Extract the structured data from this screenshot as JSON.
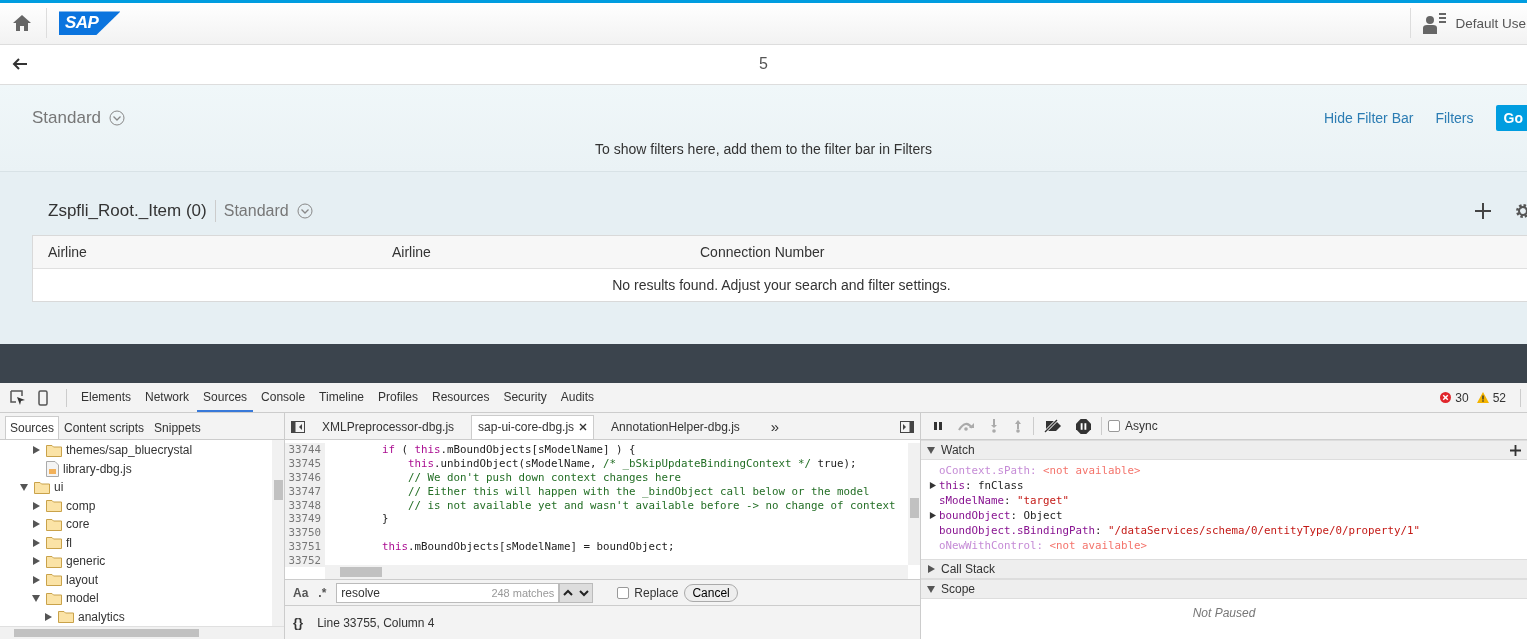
{
  "shell": {
    "logo": "SAP",
    "user": "Default Use"
  },
  "page": {
    "title": "5"
  },
  "filter_bar": {
    "variant": "Standard",
    "links": [
      "Hide Filter Bar",
      "Filters"
    ],
    "go_button": "Go",
    "message": "To show filters here, add them to the filter bar in Filters"
  },
  "table": {
    "title": "Zspfli_Root._Item (0)",
    "variant": "Standard",
    "columns": [
      "Airline",
      "Airline",
      "Connection Number"
    ],
    "no_data": "No results found. Adjust your search and filter settings."
  },
  "devtools": {
    "tabs": [
      {
        "label": "Elements",
        "selected": false
      },
      {
        "label": "Network",
        "selected": false
      },
      {
        "label": "Sources",
        "selected": true
      },
      {
        "label": "Console",
        "selected": false
      },
      {
        "label": "Timeline",
        "selected": false
      },
      {
        "label": "Profiles",
        "selected": false
      },
      {
        "label": "Resources",
        "selected": false
      },
      {
        "label": "Security",
        "selected": false
      },
      {
        "label": "Audits",
        "selected": false
      }
    ],
    "errors": "30",
    "warnings": "52",
    "navigator": {
      "tabs": [
        {
          "label": "Sources",
          "selected": true
        },
        {
          "label": "Content scripts",
          "selected": false
        },
        {
          "label": "Snippets",
          "selected": false
        }
      ],
      "tree": [
        {
          "children": [
            {
              "name": "themes/sap_bluecrystal",
              "kind": "folder",
              "expanded": false
            },
            {
              "name": "library-dbg.js",
              "kind": "file"
            }
          ]
        },
        {
          "name": "ui",
          "kind": "folder",
          "expanded": true,
          "children": [
            {
              "name": "comp",
              "kind": "folder",
              "expanded": false
            },
            {
              "name": "core",
              "kind": "folder",
              "expanded": false
            },
            {
              "name": "fl",
              "kind": "folder",
              "expanded": false
            },
            {
              "name": "generic",
              "kind": "folder",
              "expanded": false
            },
            {
              "name": "layout",
              "kind": "folder",
              "expanded": false
            },
            {
              "name": "model",
              "kind": "folder",
              "expanded": true,
              "children": [
                {
                  "name": "analytics",
                  "kind": "folder",
                  "expanded": false
                }
              ]
            }
          ]
        }
      ]
    },
    "editor": {
      "tabs": [
        {
          "label": "XMLPreprocessor-dbg.js",
          "selected": false
        },
        {
          "label": "sap-ui-core-dbg.js",
          "selected": true
        },
        {
          "label": "AnnotationHelper-dbg.js",
          "selected": false
        }
      ],
      "more": "»",
      "lines": [
        {
          "number": "33744",
          "tokens": [
            {
              "kind": "keyword",
              "text": "        if"
            },
            {
              "kind": "plain",
              "text": " ( "
            },
            {
              "kind": "keyword",
              "text": "this"
            },
            {
              "kind": "plain",
              "text": ".mBoundObjects[sModelName] ) {"
            }
          ]
        },
        {
          "number": "33745",
          "tokens": [
            {
              "kind": "keyword",
              "text": "            this"
            },
            {
              "kind": "plain",
              "text": ".unbindObject(sModelName, "
            },
            {
              "kind": "comment",
              "text": "/* _bSkipUpdateBindingContext */"
            },
            {
              "kind": "plain",
              "text": " true);"
            }
          ]
        },
        {
          "number": "33746",
          "tokens": [
            {
              "kind": "comment",
              "text": "            // We don't push down context changes here"
            }
          ]
        },
        {
          "number": "33747",
          "tokens": [
            {
              "kind": "comment",
              "text": "            // Either this will happen with the _bindObject call below or the model"
            }
          ]
        },
        {
          "number": "33748",
          "tokens": [
            {
              "kind": "comment",
              "text": "            // is not available yet and wasn't available before -> no change of context"
            }
          ]
        },
        {
          "number": "33749",
          "tokens": [
            {
              "kind": "plain",
              "text": "        }"
            }
          ]
        },
        {
          "number": "33750"
        },
        {
          "number": "33751",
          "tokens": [
            {
              "kind": "keyword",
              "text": "        this"
            },
            {
              "kind": "plain",
              "text": ".mBoundObjects[sModelName] = boundObject;"
            }
          ]
        },
        {
          "number": "33752"
        }
      ],
      "search": {
        "case_label": "Aa",
        "regex_label": ".*",
        "value": "resolve",
        "count": "248 matches",
        "replace_label": "Replace",
        "replace_checked": false,
        "cancel": "Cancel"
      },
      "format_label": "{}",
      "status": "Line 33755, Column 4"
    }
  },
  "debugger": {
    "async_label": "Async",
    "async_checked": false,
    "watch": {
      "title": "Watch",
      "expanded": true,
      "entries": [
        {
          "name": "oContext.sPath",
          "separator": ":",
          "value": "<not available>",
          "kind": "unavailable",
          "expandable": false
        },
        {
          "name": "this",
          "separator": ":",
          "value": "fnClass",
          "kind": "object",
          "expandable": true
        },
        {
          "name": "sModelName",
          "separator": ":",
          "value": "\"target\"",
          "kind": "string",
          "expandable": false
        },
        {
          "name": "boundObject",
          "separator": ":",
          "value": "Object",
          "kind": "object",
          "expandable": true
        },
        {
          "name": "boundObject.sBindingPath",
          "separator": ":",
          "value": "\"/dataServices/schema/0/entityType/0/property/1\"",
          "kind": "string",
          "expandable": false
        },
        {
          "name": "oNewWithControl",
          "separator": ":",
          "value": "<not available>",
          "kind": "unavailable",
          "expandable": false
        }
      ]
    },
    "sections": [
      {
        "title": "Call Stack",
        "expanded": false
      },
      {
        "title": "Scope",
        "expanded": true
      }
    ],
    "scope_message": "Not Paused"
  }
}
